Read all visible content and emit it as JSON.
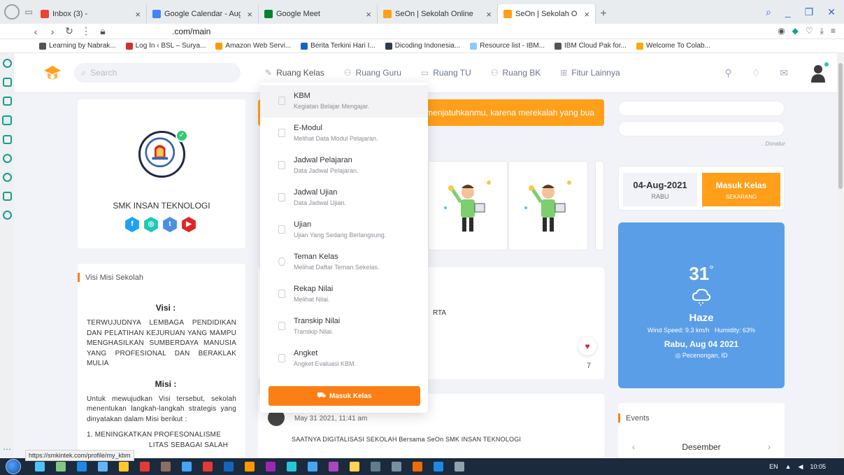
{
  "browser": {
    "tabs": [
      {
        "title": "Inbox (3) -",
        "color": "#ea4335",
        "active": false
      },
      {
        "title": "Google Calendar - August",
        "color": "#4285f4",
        "active": false
      },
      {
        "title": "Google Meet",
        "color": "#00832d",
        "active": false
      },
      {
        "title": "SeOn | Sekolah Online",
        "color": "#ff9f1a",
        "active": false
      },
      {
        "title": "SeOn | Sekolah Online",
        "color": "#ff9f1a",
        "active": true
      }
    ],
    "url": ".com/main",
    "bookmarks": [
      {
        "label": "Learning by Nabrak...",
        "color": "#555"
      },
      {
        "label": "Log In ‹ BSL – Surya...",
        "color": "#d32f2f"
      },
      {
        "label": "Amazon Web Servi...",
        "color": "#ff9900"
      },
      {
        "label": "Berita Terkini Hari I...",
        "color": "#1565c0"
      },
      {
        "label": "Dicoding Indonesia...",
        "color": "#2c3e50"
      },
      {
        "label": "Resource list - IBM...",
        "color": "#90caf9"
      },
      {
        "label": "IBM Cloud Pak for...",
        "color": "#555"
      },
      {
        "label": "Welcome To Colab...",
        "color": "#f9ab00"
      }
    ],
    "status_url": "https://smkintek.com/profile/my_kbm"
  },
  "navbar": {
    "search_placeholder": "Search",
    "menu": [
      {
        "label": "Ruang Kelas",
        "icon": "✎",
        "active": true
      },
      {
        "label": "Ruang Guru",
        "icon": "⚇",
        "active": false
      },
      {
        "label": "Ruang TU",
        "icon": "▭",
        "active": false
      },
      {
        "label": "Ruang BK",
        "icon": "⚇",
        "active": false
      },
      {
        "label": "Fitur Lainnya",
        "icon": "⊞",
        "active": false
      }
    ]
  },
  "school": {
    "name": "SMK INSAN TEKNOLOGI",
    "socials": [
      {
        "label": "f",
        "color": "#1da1f2"
      },
      {
        "label": "◎",
        "color": "#1dc9b7"
      },
      {
        "label": "t",
        "color": "#4a90e2"
      },
      {
        "label": "▶",
        "color": "#e02424"
      }
    ]
  },
  "visi_misi": {
    "header": "Visi Misi Sekolah",
    "visi_title": "Visi :",
    "visi_text": "TERWUJUDNYA LEMBAGA PENDIDIKAN DAN PELATIHAN KEJURUAN YANG MAMPU MENGHASILKAN SUMBERDAYA MANUSIA YANG PROFESIONAL DAN BERAKLAK MULIA",
    "misi_title": "Misi :",
    "misi_text": "Untuk mewujudkan Visi tersebut, sekolah menentukan langkah-langkah strategis yang dinyatakan dalam Misi berikut :",
    "misi_item": "1. MENINGKATKAN PROFESONALISME",
    "misi_item_2": "LITAS SEBAGAI SALAH"
  },
  "quote": "menjatuhkanmu, karena merekalah yang bua",
  "dropdown": {
    "items": [
      {
        "title": "KBM",
        "subtitle": "Kegiatan Belajar Mengajar."
      },
      {
        "title": "E-Modul",
        "subtitle": "Melihat Data Modul Pelajaran."
      },
      {
        "title": "Jadwal Pelajaran",
        "subtitle": "Data Jadwal Pelajaran."
      },
      {
        "title": "Jadwal Ujian",
        "subtitle": "Data Jadwal Ujian."
      },
      {
        "title": "Ujian",
        "subtitle": "Ujian Yang Sedang Berlangsung."
      },
      {
        "title": "Teman Kelas",
        "subtitle": "Melihat Daftar Teman Sekelas."
      },
      {
        "title": "Rekap Nilai",
        "subtitle": "Melihat Nilai."
      },
      {
        "title": "Transkip Nilai",
        "subtitle": "Transkip Nilai."
      },
      {
        "title": "Angket",
        "subtitle": "Angket Evaluasi KBM."
      }
    ],
    "button_label": "Masuk Kelas"
  },
  "post": {
    "text_fragment": "RTA",
    "like_count": "7"
  },
  "post2": {
    "time": "May 31 2021, 11:41 am",
    "body": "SAATNYA DIGITALISASI  SEKOLAH Bersama SeOn SMK INSAN TEKNOLOGI"
  },
  "donatur": {
    "label": ". Donatur"
  },
  "date_card": {
    "date": "04-Aug-2021",
    "day": "RABU",
    "cta_title": "Masuk Kelas",
    "cta_sub": "SEKARANG"
  },
  "weather": {
    "temp": "31",
    "unit": "°",
    "condition": "Haze",
    "wind": "Wind Speed: 9.3 km/h",
    "humidity": "Humidity: 63%",
    "date": "Rabu, Aug 04 2021",
    "location": "Pecenongan, ID",
    "bg_color": "#5b9ee8"
  },
  "events": {
    "header": "Events",
    "month": "Desember",
    "prev": "‹",
    "next": "›"
  },
  "taskbar": {
    "lang": "EN",
    "time": "10:05",
    "icons": [
      "#4fc3f7",
      "#81c784",
      "#1e88e5",
      "#64b5f6",
      "#ffca28",
      "#e53935",
      "#8d6e63",
      "#42a5f5",
      "#e53935",
      "#1565c0",
      "#ff9800",
      "#9c27b0",
      "#26c6da",
      "#42a5f5",
      "#ab47bc",
      "#ffd54f",
      "#607d8b",
      "#78909c",
      "#ef6c00",
      "#1e88e5",
      "#90a4ae"
    ]
  }
}
